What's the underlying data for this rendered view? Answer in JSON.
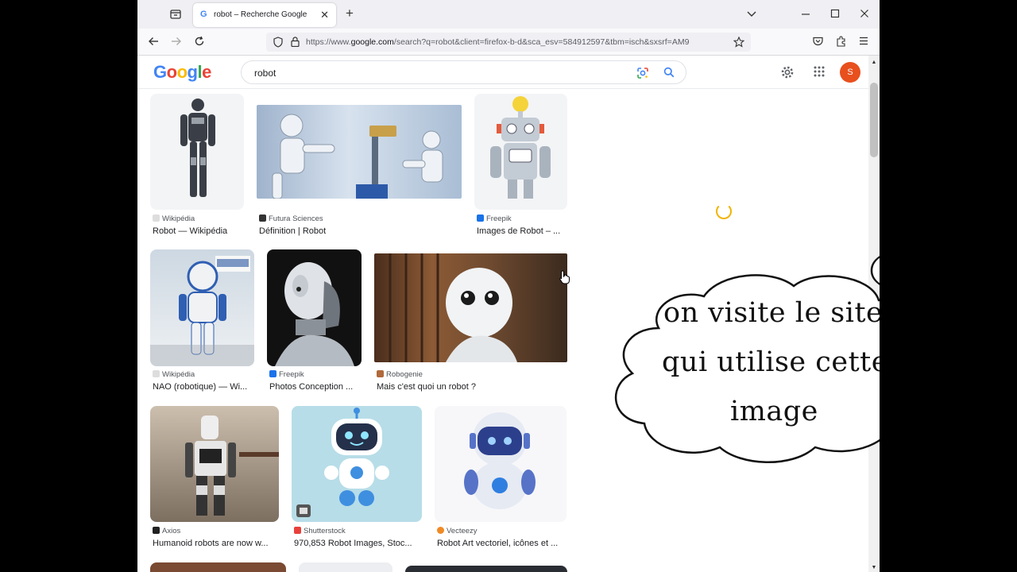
{
  "browser": {
    "tab_title": "robot – Recherche Google",
    "tab_favicon": "G",
    "new_tab": "+",
    "url_scheme": "https://www.",
    "url_host": "google.com",
    "url_path": "/search?q=robot&client=firefox-b-d&sca_esv=584912597&tbm=isch&sxsrf=AM9"
  },
  "google": {
    "logo_letters": [
      "G",
      "o",
      "o",
      "g",
      "l",
      "e"
    ],
    "logo_colors": [
      "#4285f4",
      "#ea4335",
      "#fbbc05",
      "#4285f4",
      "#34a853",
      "#ea4335"
    ],
    "query": "robot",
    "avatar_initial": "S"
  },
  "results": [
    {
      "source": "Wikipédia",
      "title": "Robot — Wikipédia",
      "icon": "wikipedia-icon",
      "color": "#555555"
    },
    {
      "source": "Futura Sciences",
      "title": "Définition | Robot",
      "icon": "futura-icon",
      "color": "#333333"
    },
    {
      "source": "Freepik",
      "title": "Images de Robot – ...",
      "icon": "freepik-icon",
      "color": "#1a73e8"
    },
    {
      "source": "Wikipédia",
      "title": "NAO (robotique) — Wi...",
      "icon": "wikipedia-icon",
      "color": "#555555"
    },
    {
      "source": "Freepik",
      "title": "Photos Conception ...",
      "icon": "freepik-icon",
      "color": "#1a73e8"
    },
    {
      "source": "Robogenie",
      "title": "Mais c'est quoi un robot ?",
      "icon": "robogenie-icon",
      "color": "#b06a3b"
    },
    {
      "source": "Axios",
      "title": "Humanoid robots are now w...",
      "icon": "axios-icon",
      "color": "#222222"
    },
    {
      "source": "Shutterstock",
      "title": "970,853 Robot Images, Stoc...",
      "icon": "shutterstock-icon",
      "color": "#e8413c"
    },
    {
      "source": "Vecteezy",
      "title": "Robot Art vectoriel, icônes et ...",
      "icon": "vecteezy-icon",
      "color": "#f08a24"
    }
  ],
  "bubble": {
    "line1": "on visite le site",
    "line2": "qui utilise cette",
    "line3": "image"
  }
}
